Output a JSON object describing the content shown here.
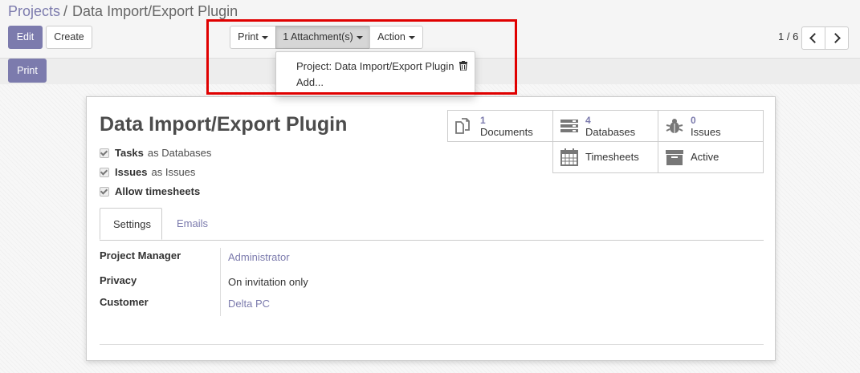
{
  "breadcrumb": {
    "parent": "Projects",
    "separator": "/",
    "current": "Data Import/Export Plugin"
  },
  "toolbar": {
    "edit_label": "Edit",
    "create_label": "Create",
    "print_label": "Print",
    "attachments_label": "1 Attachment(s)",
    "action_label": "Action"
  },
  "attachments_menu": {
    "items": [
      "Project: Data Import/Export Plugin",
      "Add..."
    ]
  },
  "pager": {
    "value": "1 / 6"
  },
  "statusbar": {
    "print_label": "Print"
  },
  "record": {
    "title": "Data Import/Export Plugin",
    "checks": [
      {
        "label": "Tasks",
        "suffix": "as Databases"
      },
      {
        "label": "Issues",
        "suffix": "as Issues"
      },
      {
        "label": "Allow timesheets",
        "suffix": ""
      }
    ],
    "stats": {
      "documents": {
        "count": "1",
        "label": "Documents"
      },
      "databases": {
        "count": "4",
        "label": "Databases"
      },
      "issues": {
        "count": "0",
        "label": "Issues"
      },
      "timesheets": {
        "label": "Timesheets"
      },
      "active": {
        "label": "Active"
      }
    },
    "tabs": [
      "Settings",
      "Emails"
    ],
    "fields": [
      {
        "label": "Project Manager",
        "value": "Administrator"
      },
      {
        "label": "Privacy",
        "value": "On invitation only"
      },
      {
        "label": "Customer",
        "value": "Delta PC"
      }
    ]
  },
  "colors": {
    "accent": "#7c7bad",
    "highlight_border": "#e00000"
  },
  "icons": [
    "trash-icon",
    "documents-icon",
    "databases-icon",
    "bug-icon",
    "calendar-icon",
    "archive-icon",
    "chevron-left-icon",
    "chevron-right-icon"
  ]
}
